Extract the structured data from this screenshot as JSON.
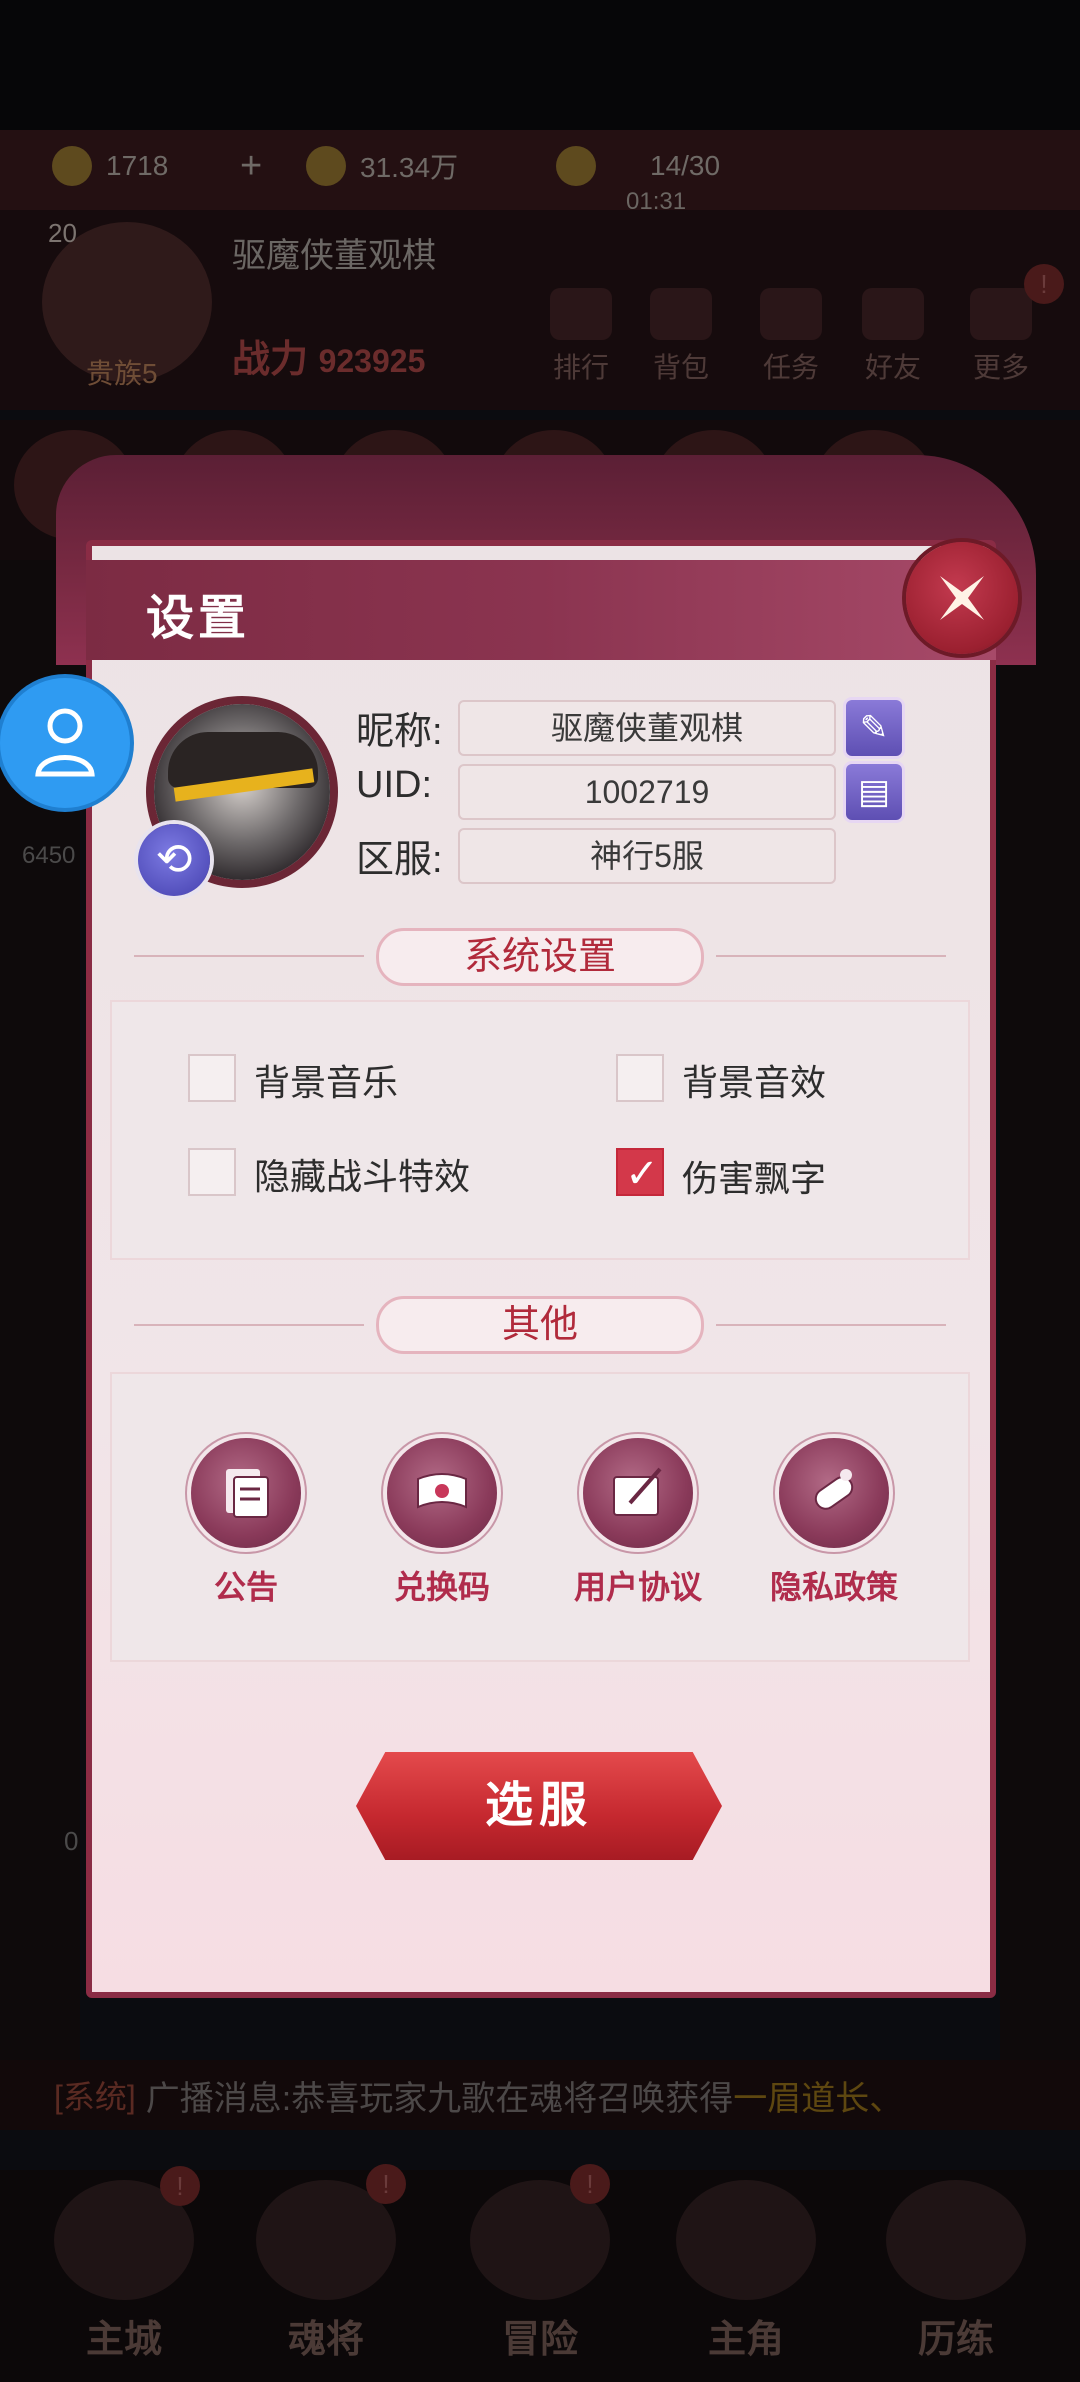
{
  "background": {
    "resources": {
      "gold": "1718",
      "plus": "+",
      "coins": "31.34万",
      "stamina": "14/30",
      "timer": "01:31"
    },
    "player": {
      "level": "20",
      "name": "驱魔侠董观棋",
      "noble": "贵族5",
      "power_label": "战力",
      "power_value": "923925"
    },
    "top_nav": [
      "排行",
      "背包",
      "任务",
      "好友",
      "更多"
    ],
    "side_value_left": "6450",
    "side_value_left2": "0",
    "broadcast": {
      "tag": "[系统]",
      "message": "广播消息:恭喜玩家九歌在魂将召唤获得",
      "highlight": "一眉道长、"
    },
    "bottom_nav": [
      "主城",
      "魂将",
      "冒险",
      "主角",
      "历练"
    ],
    "notice_dot": "!"
  },
  "settings": {
    "title": "设置",
    "profile": {
      "nickname_label": "昵称:",
      "nickname": "驱魔侠董观棋",
      "uid_label": "UID:",
      "uid": "1002719",
      "server_label": "区服:",
      "server": "神行5服"
    },
    "system_header": "系统设置",
    "options": [
      {
        "label": "背景音乐",
        "checked": false
      },
      {
        "label": "背景音效",
        "checked": false
      },
      {
        "label": "隐藏战斗特效",
        "checked": false
      },
      {
        "label": "伤害飘字",
        "checked": true
      }
    ],
    "check_glyph": "✓",
    "other_header": "其他",
    "others": [
      {
        "label": "公告",
        "icon": "announcement-icon"
      },
      {
        "label": "兑换码",
        "icon": "redeem-code-icon"
      },
      {
        "label": "用户协议",
        "icon": "user-agreement-icon"
      },
      {
        "label": "隐私政策",
        "icon": "privacy-policy-icon"
      }
    ],
    "select_server_label": "选服"
  },
  "colors": {
    "accent": "#8a2c45",
    "button_red": "#c5282f",
    "float_button": "#2f9bf2"
  }
}
